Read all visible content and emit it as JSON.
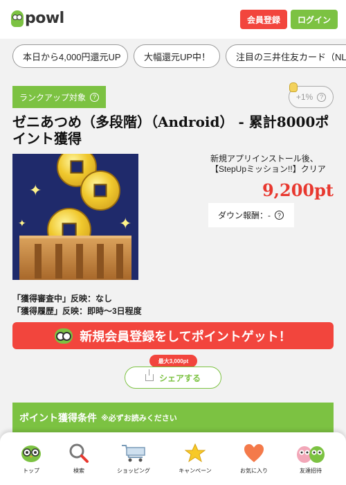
{
  "header": {
    "logo_text": "powl",
    "register_label": "会員登録",
    "login_label": "ログイン"
  },
  "tags": [
    "本日から4,000円還元UP",
    "大幅還元UP中！",
    "注目の三井住友カード（NL"
  ],
  "offer": {
    "rank_badge": "ランクアップ対象",
    "rate": "+1%",
    "title": "ゼニあつめ（多段階）（Android） - 累計8000ポイント獲得",
    "description": "新規アプリインストール後、【StepUpミッション!!】クリア",
    "points": "9,200pt",
    "down_reward": "ダウン報酬：-",
    "notes": [
      "「獲得審査中」反映：なし",
      "「獲得履歴」反映：即時～3日程度"
    ],
    "cta_label": "新規会員登録をしてポイントゲット！",
    "share_tip": "最大3,000pt",
    "share_label": "シェアする",
    "conditions_title": "ポイント獲得条件",
    "conditions_note": "※必ずお読みください"
  },
  "nav": [
    {
      "label": "トップ",
      "icon": "owl-icon"
    },
    {
      "label": "検索",
      "icon": "search-icon"
    },
    {
      "label": "ショッピング",
      "icon": "cart-icon"
    },
    {
      "label": "キャンペーン",
      "icon": "star-icon"
    },
    {
      "label": "お気に入り",
      "icon": "heart-icon"
    },
    {
      "label": "友達招待",
      "icon": "friends-icon"
    }
  ],
  "colors": {
    "brand_green": "#7cc242",
    "accent_red": "#f2453d",
    "points_red": "#e8382f"
  }
}
